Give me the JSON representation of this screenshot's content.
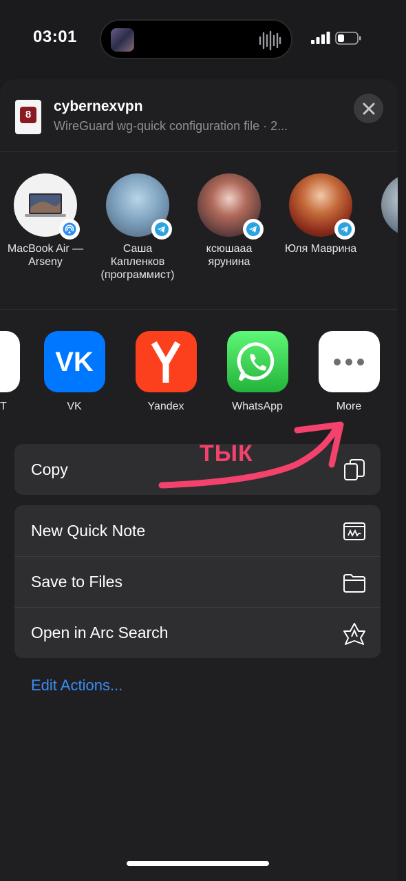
{
  "status_bar": {
    "time": "03:01"
  },
  "file": {
    "title": "cybernexvpn",
    "subtitle": "WireGuard wg-quick configuration file · 2...",
    "icon_glyph": "8"
  },
  "people": [
    {
      "name": "MacBook Air — Arseny",
      "badge": "airdrop-icon"
    },
    {
      "name": "Саша Капленков (программист)",
      "badge": "telegram-icon"
    },
    {
      "name": "ксюшааа ярунина",
      "badge": "telegram-icon"
    },
    {
      "name": "Юля Маврина",
      "badge": "telegram-icon"
    }
  ],
  "apps": [
    {
      "label": "T"
    },
    {
      "label": "VK",
      "color": "#0077ff"
    },
    {
      "label": "Yandex",
      "color": "#fc3f1d"
    },
    {
      "label": "WhatsApp",
      "color": "#25d366"
    },
    {
      "label": "More",
      "color": "#ffffff"
    }
  ],
  "actions_primary": [
    {
      "label": "Copy",
      "icon": "copy-icon"
    }
  ],
  "actions_secondary": [
    {
      "label": "New Quick Note",
      "icon": "quick-note-icon"
    },
    {
      "label": "Save to Files",
      "icon": "folder-icon"
    },
    {
      "label": "Open in Arc Search",
      "icon": "arc-search-icon"
    }
  ],
  "edit_actions": "Edit Actions...",
  "annotation": {
    "text": "ТЫК",
    "color": "#f5426c"
  }
}
